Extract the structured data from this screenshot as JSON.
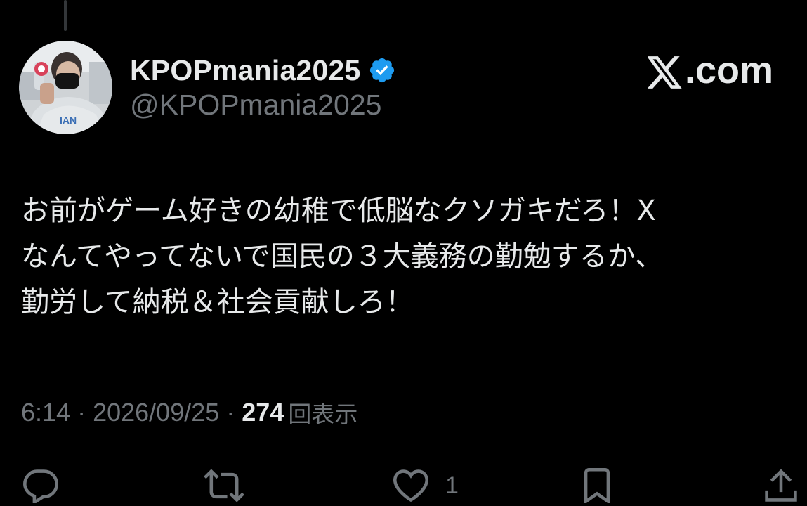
{
  "author": {
    "display_name": "KPOPmania2025",
    "handle": "@KPOPmania2025",
    "verified_color": "#1d9bf0"
  },
  "brand": {
    "label": ".com"
  },
  "tweet": {
    "lines": [
      "お前がゲーム好きの幼稚で低脳なクソガキだろ！X",
      "なんてやってないで国民の３大義務の勤勉するか、",
      "勤労して納税＆社会貢献しろ！"
    ]
  },
  "meta": {
    "time": "6:14",
    "separator1": " · ",
    "date": "2026/09/25",
    "separator2": " · ",
    "views_count": "274",
    "views_label": "回表示"
  },
  "actions": {
    "reply_icon": "reply-icon",
    "retweet_icon": "retweet-icon",
    "like_icon": "heart-icon",
    "like_count": "1",
    "bookmark_icon": "bookmark-icon",
    "share_icon": "share-icon"
  },
  "colors": {
    "background": "#000000",
    "text_primary": "#e7e9ea",
    "text_secondary": "#71767b"
  }
}
